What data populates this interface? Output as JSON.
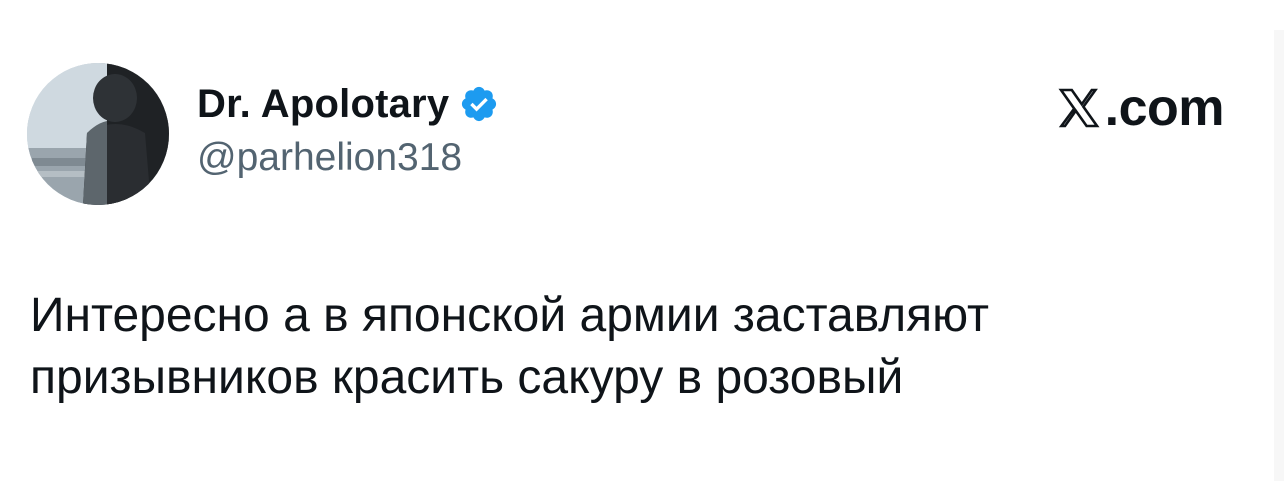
{
  "author": {
    "display_name": "Dr. Apolotary",
    "handle": "@parhelion318",
    "verified": true,
    "verified_color": "#1d9bf0"
  },
  "brand": {
    "label": ".com",
    "logo": "x-logo-icon"
  },
  "tweet": {
    "text": "Интересно а в японской армии заставляют\nпризывников красить сакуру в розовый"
  },
  "colors": {
    "text": "#0f1419",
    "secondary": "#536471",
    "background": "#ffffff"
  }
}
